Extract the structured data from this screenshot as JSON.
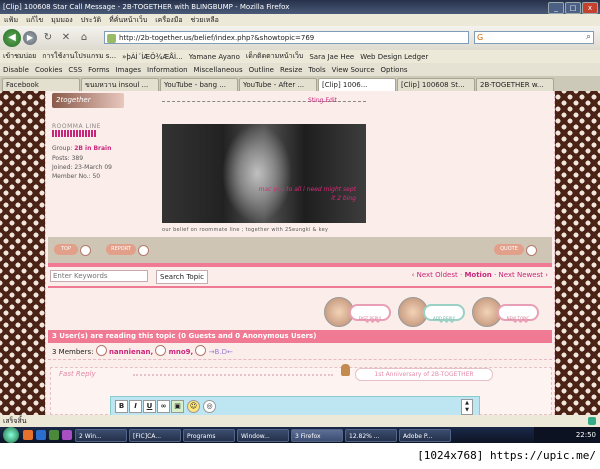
{
  "window": {
    "title": "[Clip] 100608 Star Call Message - 2B-TOGETHER with BLINGBUMP - Mozilla Firefox",
    "minimize": "_",
    "maximize": "□",
    "close": "x"
  },
  "menu": [
    "แฟ้ม",
    "แก้ไข",
    "มุมมอง",
    "ประวัติ",
    "ที่คั่นหน้าเว็บ",
    "เครื่องมือ",
    "ช่วยเหลือ"
  ],
  "nav": {
    "url": "http://2b-together.us/belief/index.php?&showtopic=769",
    "search_engine": "G"
  },
  "bookmarks": [
    "เข้าชมบ่อย",
    "การใช้งานโปรแกรม s...",
    "»þÀÌ´ÍÆÖ¾ÆÅÌ...",
    "Yamane Ayano",
    "เด็กติดตามหน้าเว็บ",
    "Sara Jae Hee",
    "Web Design Ledger"
  ],
  "webdev": [
    "Disable",
    "Cookies",
    "CSS",
    "Forms",
    "Images",
    "Information",
    "Miscellaneous",
    "Outline",
    "Resize",
    "Tools",
    "View Source",
    "Options"
  ],
  "tabs": [
    {
      "label": "Facebook",
      "active": false
    },
    {
      "label": "ขนมหวาน insoul ...",
      "active": false
    },
    {
      "label": "YouTube - bang ...",
      "active": false
    },
    {
      "label": "YouTube - After ...",
      "active": false
    },
    {
      "label": "[Clip] 1006...",
      "active": true
    },
    {
      "label": "[Clip] 100608 St...",
      "active": false
    },
    {
      "label": "2B-TOGETHER w...",
      "active": false
    }
  ],
  "post": {
    "logo_text": "2together",
    "user_role": "ROOMMA LINE",
    "group_label": "Group:",
    "group_value": "2B in Brain",
    "posts": "Posts: 389",
    "joined": "Joined: 23-March 09",
    "member_no": "Member No.: 50",
    "top_link": "Sting Edit",
    "photo_line1": "mac you to all i need might sept",
    "photo_line2": "it 2 bing",
    "caption": "our belief on roommate line ; together with 2Seungki & key",
    "btn_top": "TOP",
    "btn_report": "REPORT",
    "btn_quote": "QUOTE"
  },
  "forum": {
    "keywords_placeholder": "Enter Keywords",
    "search_button": "Search Topic",
    "pagination": {
      "prev": "‹ Next Oldest",
      "current": "Motion",
      "next": "Next Newest ›",
      "sep": "·"
    },
    "actions": [
      {
        "label": "FAST REPLY"
      },
      {
        "label": "ADD REPLY"
      },
      {
        "label": "NEW TOPIC"
      }
    ],
    "reading_text": "3 User(s) are reading this topic (0 Guests and 0 Anonymous Users)",
    "members_label": "3 Members:",
    "members": [
      "nannienan,",
      "mno9,",
      "→B.D←"
    ],
    "quick_reply_label": "Fast Reply",
    "quick_reply_banner": "1st Anniversary of 2B-TOGETHER",
    "editor_buttons": [
      "B",
      "I",
      "U",
      "∞",
      "▣",
      "☺",
      "◎"
    ]
  },
  "status": {
    "text": "เสร็จสิ้น"
  },
  "taskbar": {
    "tasks": [
      {
        "label": "2 Win...",
        "active": false
      },
      {
        "label": "[FIC]CA...",
        "active": false
      },
      {
        "label": "Programs",
        "active": false
      },
      {
        "label": "Window...",
        "active": false
      },
      {
        "label": "3 Firefox",
        "active": true
      },
      {
        "label": "12.82% ...",
        "active": false
      },
      {
        "label": "Adobe P...",
        "active": false
      }
    ],
    "clock": "22:50"
  },
  "watermark": "[1024x768] https://upic.me/"
}
